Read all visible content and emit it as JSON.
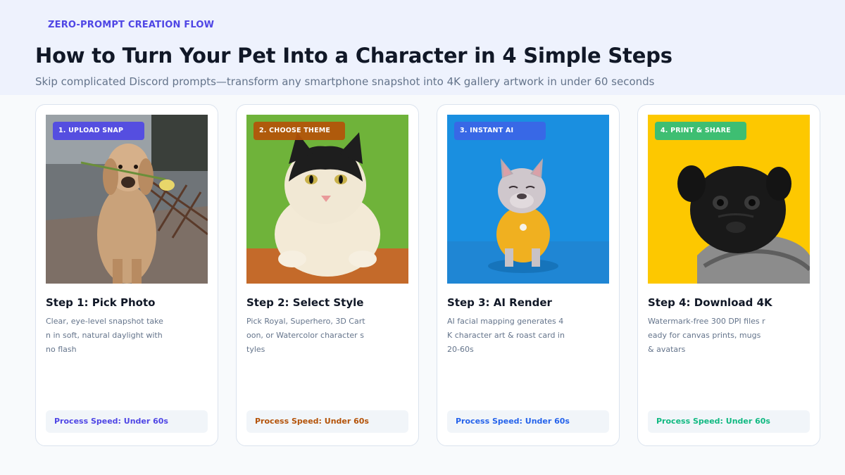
{
  "header": {
    "eyebrow": "ZERO-PROMPT CREATION FLOW",
    "title": "How to Turn Your Pet Into a Character in 4 Simple Steps",
    "subtitle": "Skip complicated Discord prompts—transform any smartphone snapshot into 4K gallery artwork in under 60 seconds"
  },
  "steps": [
    {
      "badge": "1. UPLOAD SNAP",
      "title": "Step 1: Pick Photo",
      "description": "Clear, eye-level snapshot taken in soft, natural daylight with no flash",
      "speed": "Process Speed: Under 60s",
      "accent": "#4f46e5",
      "photo": "golden-retriever-with-flower"
    },
    {
      "badge": "2. CHOOSE THEME",
      "title": "Step 2: Select Style",
      "description": "Pick Royal, Superhero, 3D Cartoon, or Watercolor character styles",
      "speed": "Process Speed: Under 60s",
      "accent": "#b45309",
      "photo": "cat-on-green-background"
    },
    {
      "badge": "3. INSTANT AI",
      "title": "Step 3: AI Render",
      "description": "AI facial mapping generates 4K character art & roast card in 20-60s",
      "speed": "Process Speed: Under 60s",
      "accent": "#2563eb",
      "photo": "french-bulldog-yellow-shirt"
    },
    {
      "badge": "4. PRINT & SHARE",
      "title": "Step 4: Download 4K",
      "description": "Watermark-free 300 DPI files ready for canvas prints, mugs & avatars",
      "speed": "Process Speed: Under 60s",
      "accent": "#10b981",
      "photo": "pug-in-sweater"
    }
  ]
}
